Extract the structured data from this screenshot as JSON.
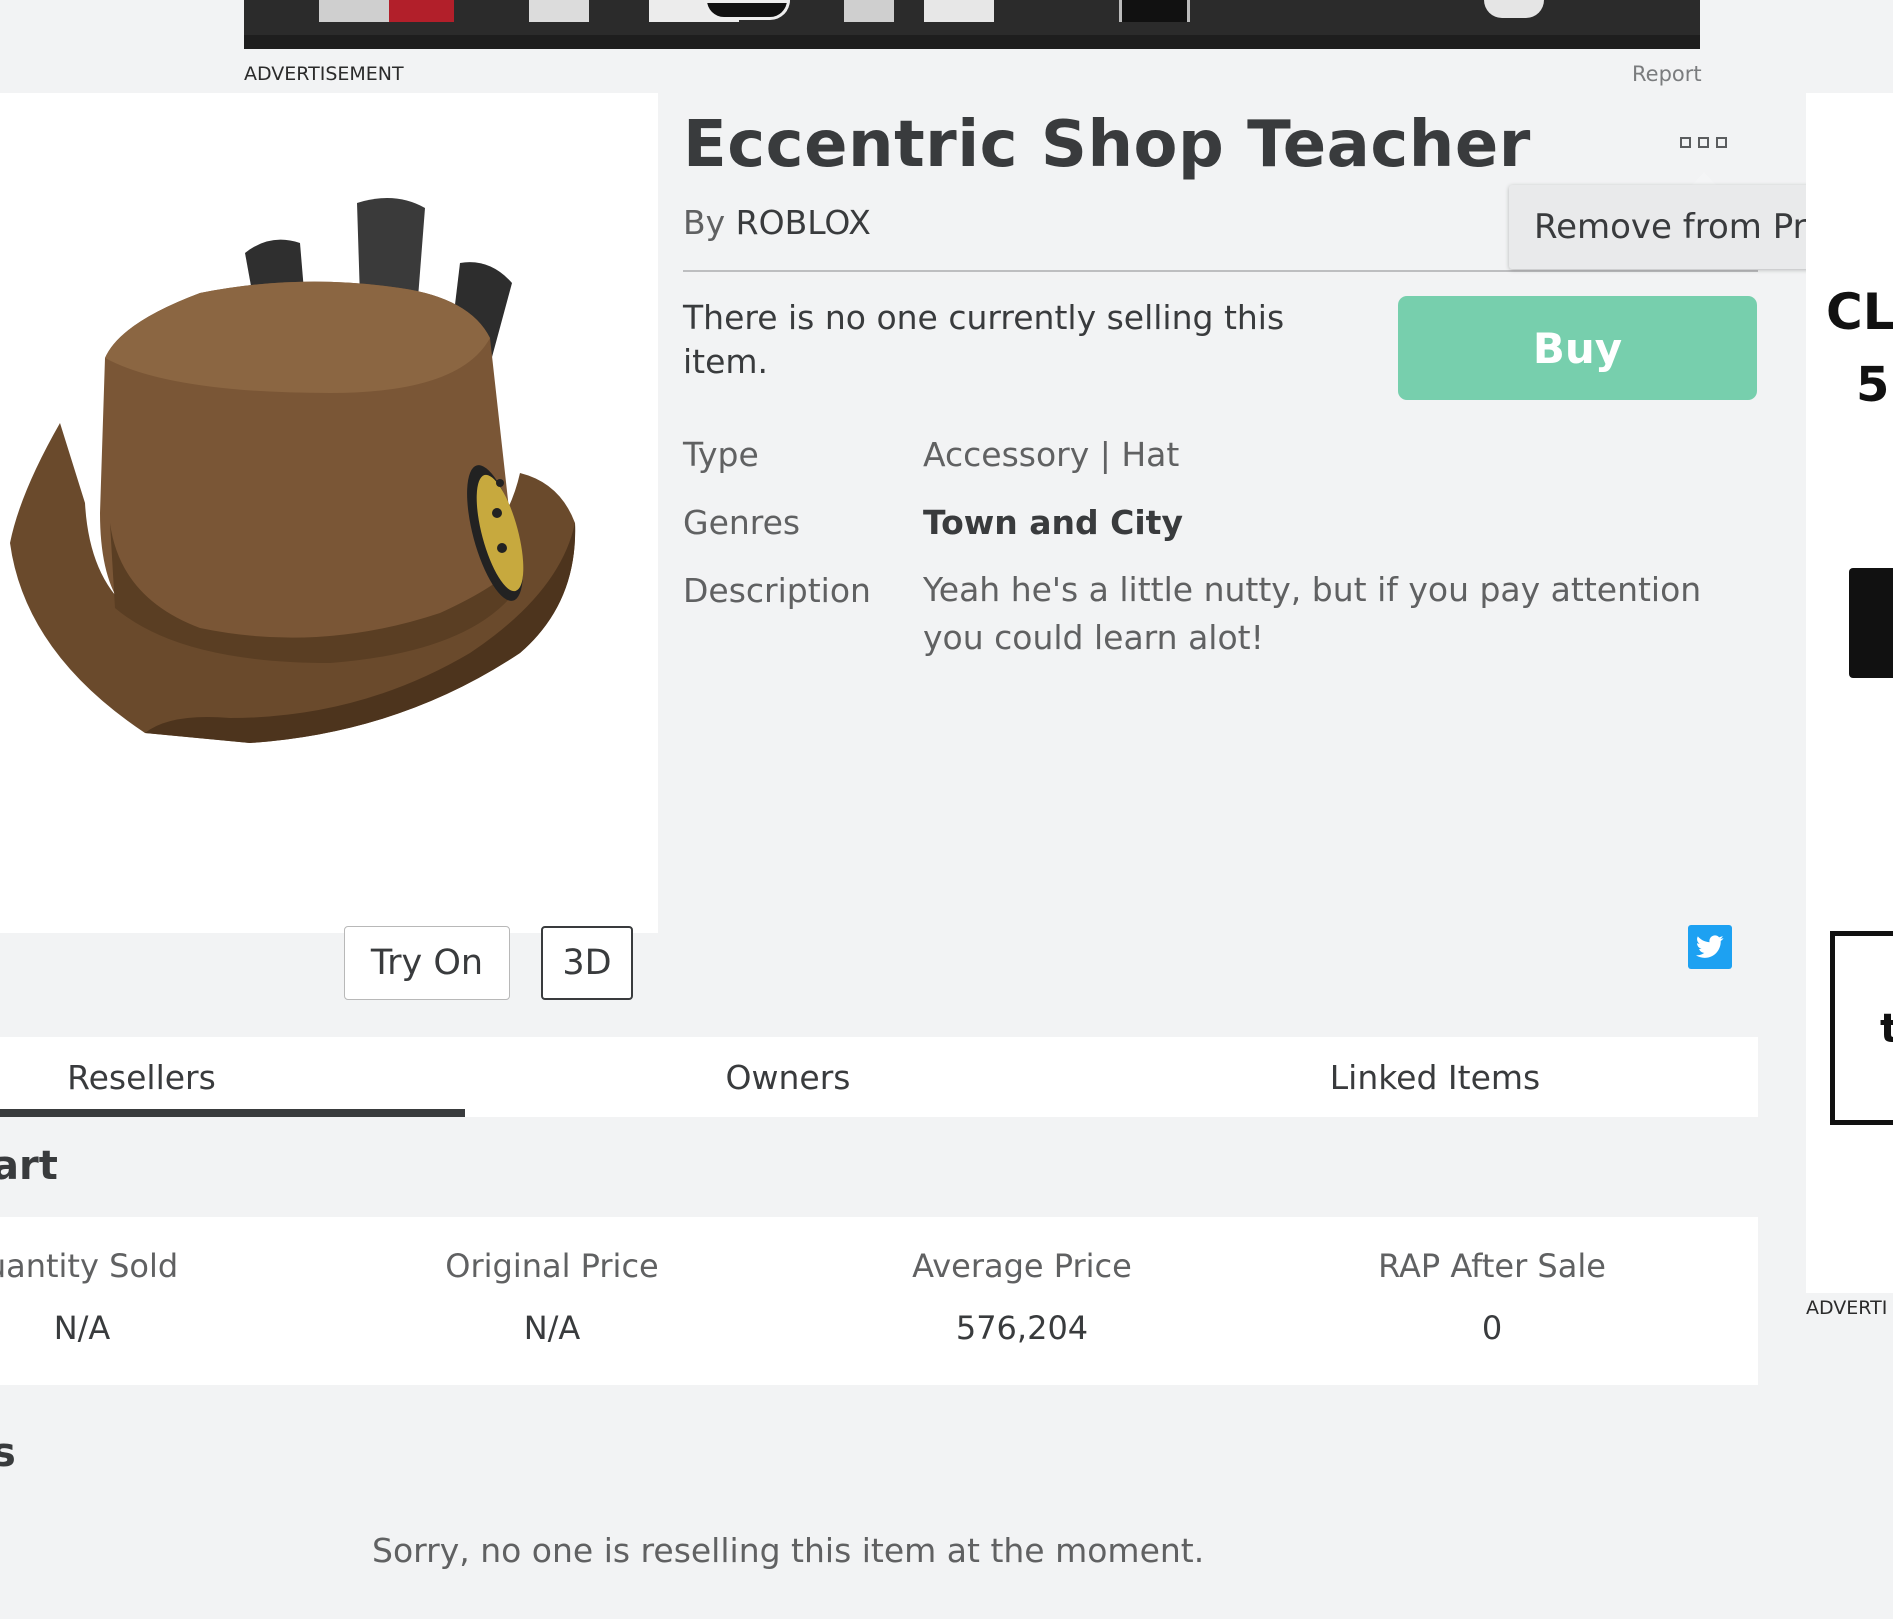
{
  "ads": {
    "top_label": "ADVERTISEMENT",
    "report_label": "Report",
    "right_label": "ADVERTI",
    "right_text_1": "CL",
    "right_text_2": "5",
    "right_text_3": "t"
  },
  "item": {
    "title": "Eccentric Shop Teacher",
    "creator_prefix": "By",
    "creator_name": "ROBLOX",
    "no_sellers_text": "There is no one currently selling this item.",
    "buy_label": "Buy",
    "fields": {
      "type_label": "Type",
      "type_value": "Accessory | Hat",
      "genres_label": "Genres",
      "genres_value": "Town and City",
      "description_label": "Description",
      "description_value": "Yeah he's a little nutty, but if you pay attention you could learn alot!"
    }
  },
  "menu": {
    "remove_label": "Remove from Profile"
  },
  "thumbnail": {
    "try_on_label": "Try On",
    "three_d_label": "3D"
  },
  "tabs": [
    {
      "label": "Resellers",
      "active": true
    },
    {
      "label": "Owners",
      "active": false
    },
    {
      "label": "Linked Items",
      "active": false
    }
  ],
  "chart_section": {
    "heading": "art"
  },
  "stats": [
    {
      "label": "uantity Sold",
      "value": "N/A"
    },
    {
      "label": "Original Price",
      "value": "N/A"
    },
    {
      "label": "Average Price",
      "value": "576,204"
    },
    {
      "label": "RAP After Sale",
      "value": "0"
    }
  ],
  "resellers_section": {
    "heading": "s",
    "empty_text": "Sorry, no one is reselling this item at the moment."
  },
  "colors": {
    "buy_button": "#77cfad",
    "twitter": "#1da1f2",
    "page_bg": "#f2f3f4"
  },
  "icons": {
    "more": "ellipsis-squares-icon",
    "twitter": "twitter-bird-icon"
  }
}
